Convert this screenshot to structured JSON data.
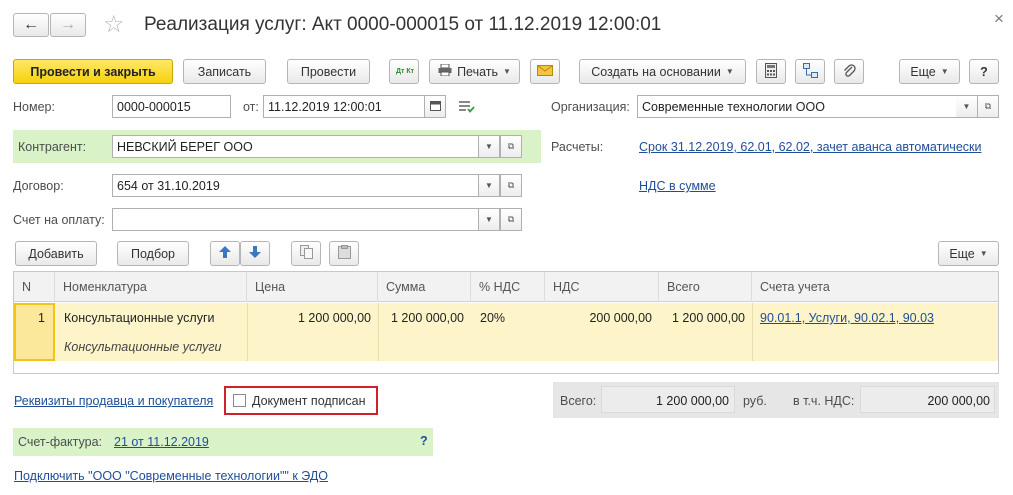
{
  "header": {
    "back_glyph": "←",
    "forward_glyph": "→",
    "star_glyph": "☆",
    "title": "Реализация услуг: Акт 0000-000015 от 11.12.2019 12:00:01",
    "close_glyph": "×"
  },
  "toolbar": {
    "post_close": "Провести и закрыть",
    "save": "Записать",
    "post": "Провести",
    "dt_kt": "Дт Кт",
    "print": "Печать",
    "create_based": "Создать на основании",
    "more": "Еще",
    "help": "?"
  },
  "form": {
    "number_label": "Номер:",
    "number_value": "0000-000015",
    "date_label": "от:",
    "date_value": "11.12.2019 12:00:01",
    "org_label": "Организация:",
    "org_value": "Современные технологии ООО",
    "counterparty_label": "Контрагент:",
    "counterparty_value": "НЕВСКИЙ БЕРЕГ ООО",
    "settlements_label": "Расчеты:",
    "settlements_link": "Срок 31.12.2019, 62.01, 62.02, зачет аванса автоматически",
    "contract_label": "Договор:",
    "contract_value": "654 от 31.10.2019",
    "vat_link": "НДС в сумме",
    "invoice_label": "Счет на оплату:",
    "invoice_value": ""
  },
  "table_toolbar": {
    "add": "Добавить",
    "pick": "Подбор",
    "more": "Еще"
  },
  "table": {
    "columns": [
      "N",
      "Номенклатура",
      "Цена",
      "Сумма",
      "% НДС",
      "НДС",
      "Всего",
      "Счета учета"
    ],
    "rows": [
      {
        "n": "1",
        "item": "Консультационные услуги",
        "item_sub": "Консультационные услуги",
        "price": "1 200 000,00",
        "sum": "1 200 000,00",
        "vat_rate": "20%",
        "vat": "200 000,00",
        "total": "1 200 000,00",
        "accounts": "90.01.1, Услуги, 90.02.1, 90.03"
      }
    ]
  },
  "footer": {
    "requisites_link": "Реквизиты продавца и покупателя",
    "signed_label": "Документ подписан",
    "signed_checked": false,
    "total_label": "Всего:",
    "total_value": "1 200 000,00",
    "currency": "руб.",
    "vat_label": "в т.ч. НДС:",
    "vat_value": "200 000,00",
    "invoice_label": "Счет-фактура:",
    "invoice_link": "21 от 11.12.2019",
    "help": "?",
    "edo_link": "Подключить \"ООО \"Современные технологии\"\" к ЭДО"
  },
  "colors": {
    "accent_yellow": "#f7d10c",
    "link_blue": "#1f4e99",
    "green_highlight": "#d9f2c7",
    "row_highlight": "#fdf5c9",
    "red_outline": "#d0202a"
  }
}
